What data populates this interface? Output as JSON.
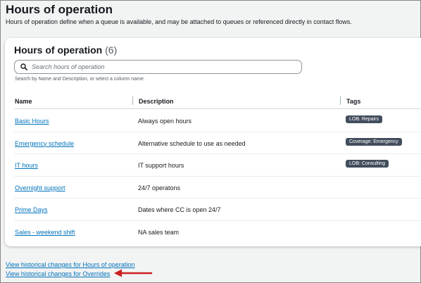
{
  "header": {
    "title": "Hours of operation",
    "description": "Hours of operation define when a queue is available, and may be attached to queues or referenced directly in contact flows."
  },
  "card": {
    "title": "Hours of operation",
    "count": "(6)",
    "search": {
      "placeholder": "Search hours of operation",
      "value": "",
      "hint": "Search by Name and Description, or select a column name."
    },
    "columns": {
      "name": "Name",
      "description": "Description",
      "tags": "Tags"
    },
    "rows": [
      {
        "name": "Basic Hours",
        "description": "Always open hours",
        "tag": "LOB: Repairs"
      },
      {
        "name": "Emergency schedule",
        "description": "Alternative schedule to use as needed",
        "tag": "Coverage: Emergency"
      },
      {
        "name": "IT hours",
        "description": "IT support hours",
        "tag": "LOB: Consulting"
      },
      {
        "name": "Overnight support",
        "description": "24/7 operatons",
        "tag": ""
      },
      {
        "name": "Prime Days",
        "description": "Dates where CC is open 24/7",
        "tag": ""
      },
      {
        "name": "Sales - weekend shift",
        "description": "NA sales team",
        "tag": ""
      }
    ]
  },
  "footer": {
    "history_hours_link": "View historical changes for Hours of operation",
    "history_overrides_link": "View historical changes for Overrides"
  },
  "colors": {
    "link": "#0073bb",
    "tag_bg": "#414d5c",
    "annotation_arrow": "#cc1f1f"
  },
  "icons": {
    "search": "search-icon",
    "annotation": "red-arrow-icon"
  }
}
